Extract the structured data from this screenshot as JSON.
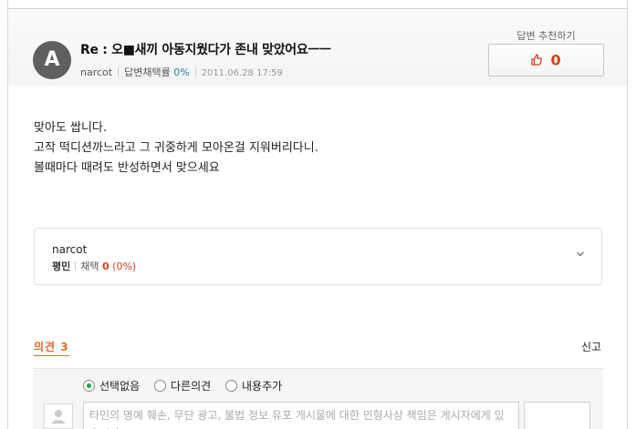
{
  "answer": {
    "avatar_letter": "A",
    "title": "Re : 오■새끼 아동지웠다가 존내 맞았어요ㅡㅡ",
    "author": "narcot",
    "adopt_label": "답변채택률",
    "adopt_rate": "0%",
    "date": "2011.06.28 17:59"
  },
  "recommend": {
    "label": "답변 추천하기",
    "count": "0",
    "icon": "thumbs-up-icon",
    "count_color": "#d0421b"
  },
  "body": {
    "lines": [
      "맞아도 쌉니다.",
      "고작 떡디션까느라고 그 귀중하게 모아온걸 지워버리다니.",
      "볼때마다 때려도 반성하면서 맞으세요"
    ]
  },
  "profile": {
    "name": "narcot",
    "rank": "평민",
    "adopt_label": "채택",
    "adopt_count": "0",
    "adopt_pct": "(0%)",
    "expand_icon": "chevron-down-icon"
  },
  "comments": {
    "count_label": "의견 3",
    "report_label": "신고",
    "accent_color": "#e0692a",
    "options": [
      "선택없음",
      "다른의견",
      "내용추가"
    ],
    "selected_option": "선택없음",
    "placeholder": "타인의 명예 훼손, 무단 광고, 불법 정보 유포 게시물에 대한 민형사상 책임은 게시자에게 있습니다."
  }
}
